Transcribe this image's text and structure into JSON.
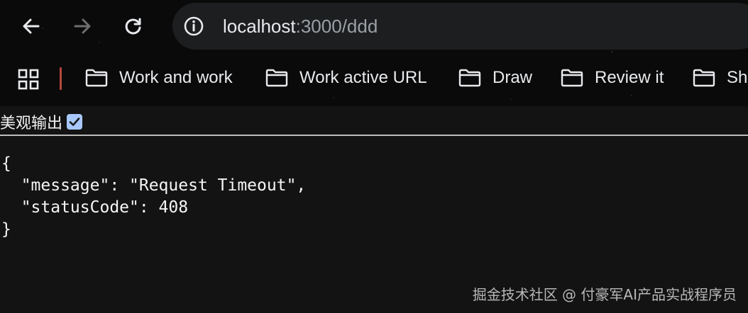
{
  "browser": {
    "nav": {
      "back_icon": "arrow-left-icon",
      "forward_icon": "arrow-right-icon",
      "reload_icon": "reload-icon"
    },
    "address_bar": {
      "host": "localhost",
      "rest": ":3000/ddd",
      "site_info_icon": "info-icon"
    },
    "bookmarks": [
      {
        "label": "Work and work"
      },
      {
        "label": "Work active URL"
      },
      {
        "label": "Draw"
      },
      {
        "label": "Review it"
      },
      {
        "label": "Sh"
      }
    ]
  },
  "page": {
    "pretty_print_label": "美观输出",
    "pretty_print_checked": true,
    "json_lines": {
      "open": "{",
      "message_line": "  \"message\": \"Request Timeout\",",
      "status_line": "  \"statusCode\": 408",
      "close": "}"
    }
  },
  "watermark": "掘金技术社区 @ 付豪军AI产品实战程序员",
  "colors": {
    "page_bg": "#131313",
    "chrome_bg": "#0a0a0a",
    "omnibox_bg": "#1d1e20",
    "checkbox": "#a8c8fb",
    "separator": "#b6473a"
  }
}
